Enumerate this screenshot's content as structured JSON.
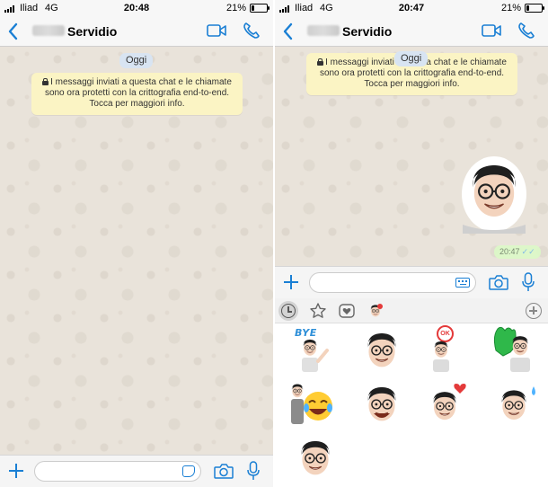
{
  "left_screen": {
    "status": {
      "carrier": "Iliad",
      "network": "4G",
      "time": "20:48",
      "battery": "21%",
      "battery_fraction": 0.21
    },
    "header": {
      "contact_name": "Servidio"
    },
    "date_label": "Oggi",
    "encryption_notice": {
      "line1": "I messaggi inviati a questa chat e le chiamate",
      "line2": "sono ora protetti con la crittografia end-to-end.",
      "line3": "Tocca per maggiori info."
    }
  },
  "right_screen": {
    "status": {
      "carrier": "Iliad",
      "network": "4G",
      "time": "20:47",
      "battery": "21%",
      "battery_fraction": 0.21
    },
    "header": {
      "contact_name": "Servidio"
    },
    "date_label": "Oggi",
    "encryption_notice": {
      "line1": "I messaggi inviati a questa chat e le chiamate",
      "line2": "sono ora protetti con la crittografia end-to-end.",
      "line3": "Tocca per maggiori info."
    },
    "sent_message": {
      "time": "20:47",
      "ticks": "✓✓"
    },
    "sticker_panel": {
      "tabs": [
        "recent-icon",
        "star-icon",
        "heart-icon",
        "sticker-pack-icon",
        "add-icon"
      ],
      "stickers": [
        {
          "name": "bye",
          "label": "BYE"
        },
        {
          "name": "smile",
          "label": ""
        },
        {
          "name": "ok",
          "label": "OK"
        },
        {
          "name": "thumbs-up",
          "label": ""
        },
        {
          "name": "laughing",
          "label": ""
        },
        {
          "name": "grin",
          "label": ""
        },
        {
          "name": "heart",
          "label": ""
        },
        {
          "name": "tear",
          "label": ""
        },
        {
          "name": "neutral",
          "label": ""
        }
      ]
    }
  },
  "colors": {
    "accent": "#1a7fd4",
    "notice_bg": "#fbf4c4",
    "date_pill_bg": "#d8e4f2",
    "outgoing_bubble": "#dcf8c6"
  }
}
